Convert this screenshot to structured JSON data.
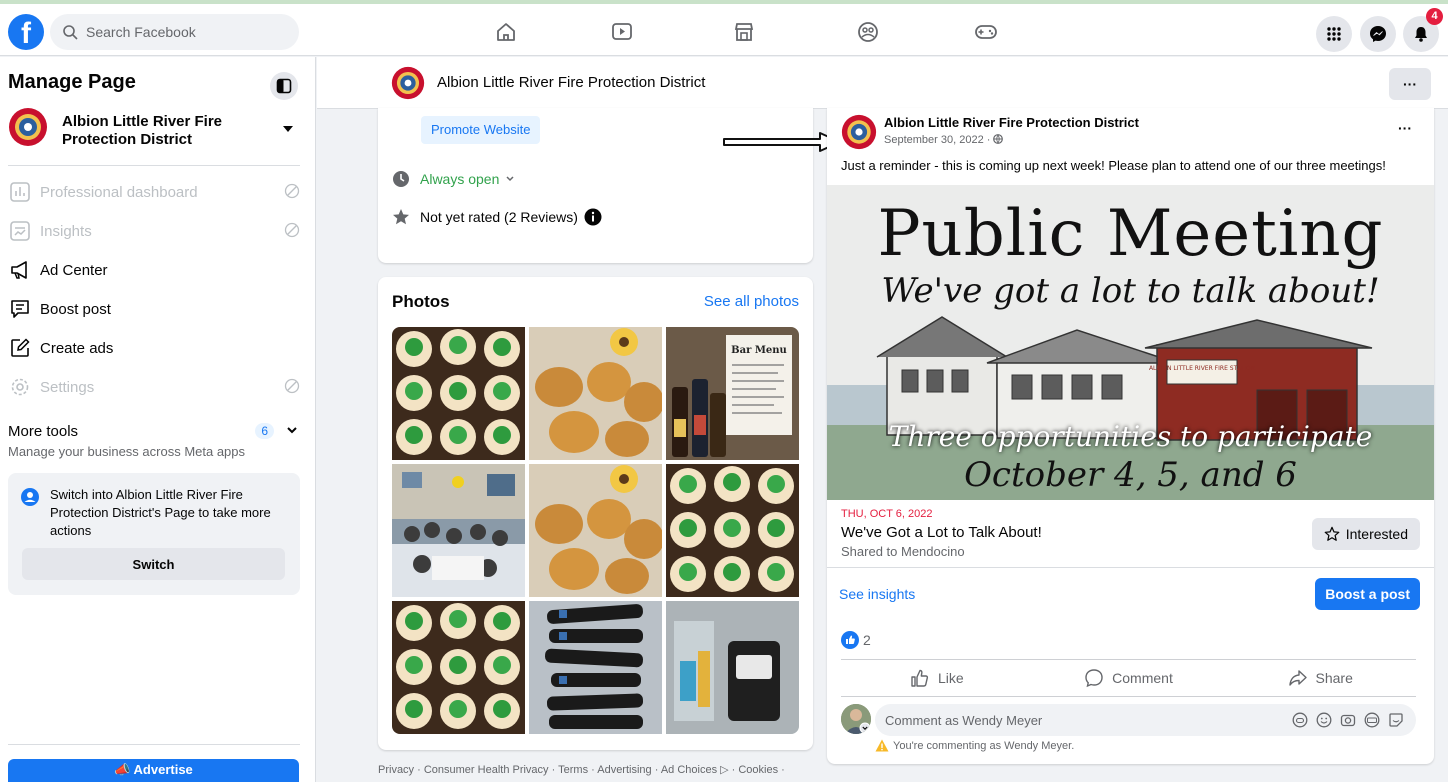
{
  "topbar": {
    "search_placeholder": "Search Facebook",
    "notification_count": "4",
    "brand_color": "#1877f2"
  },
  "sidebar": {
    "title": "Manage Page",
    "page_name": "Albion Little River Fire Protection District",
    "items": [
      {
        "label": "Professional dashboard",
        "icon": "dashboard-icon",
        "disabled": true
      },
      {
        "label": "Insights",
        "icon": "insights-icon",
        "disabled": true
      },
      {
        "label": "Ad Center",
        "icon": "megaphone-icon",
        "disabled": false
      },
      {
        "label": "Boost post",
        "icon": "boost-post-icon",
        "disabled": false
      },
      {
        "label": "Create ads",
        "icon": "pencil-square-icon",
        "disabled": false
      },
      {
        "label": "Settings",
        "icon": "gear-icon",
        "disabled": true
      }
    ],
    "more_tools": {
      "title": "More tools",
      "count": "6",
      "subtitle": "Manage your business across Meta apps"
    },
    "switch_box": {
      "text": "Switch into Albion Little River Fire Protection District's Page to take more actions",
      "button": "Switch"
    },
    "advertise_label": "Advertise"
  },
  "page_header": {
    "name": "Albion Little River Fire Protection District"
  },
  "about": {
    "promote_label": "Promote Website",
    "hours": "Always open",
    "rating": "Not yet rated (2 Reviews)"
  },
  "photos": {
    "title": "Photos",
    "see_all": "See all photos",
    "bar_menu_title": "Bar Menu"
  },
  "footer": {
    "text": "Privacy · Consumer Health Privacy · Terms · Advertising · Ad Choices ▷ · Cookies ·"
  },
  "post": {
    "author": "Albion Little River Fire Protection District",
    "date": "September 30, 2022 ·",
    "text": "Just a reminder - this is coming up next week!  Please plan to attend one of our three meetings!",
    "banner": {
      "headline": "Public Meeting",
      "tagline": "We've got a lot to talk about!",
      "building_sign": "ALBION LITTLE RIVER FIRE STATION",
      "opportunities": "Three opportunities to participate",
      "dates": "October 4, 5, and 6"
    },
    "event": {
      "date": "THU, OCT 6, 2022",
      "title": "We've Got a Lot to Talk About!",
      "shared": "Shared to Mendocino",
      "interested_label": "Interested"
    },
    "see_insights": "See insights",
    "boost_label": "Boost a post",
    "reaction_count": "2",
    "actions": {
      "like": "Like",
      "comment": "Comment",
      "share": "Share"
    },
    "comment_placeholder": "Comment as Wendy Meyer",
    "commenting_as": "You're commenting as Wendy Meyer."
  }
}
